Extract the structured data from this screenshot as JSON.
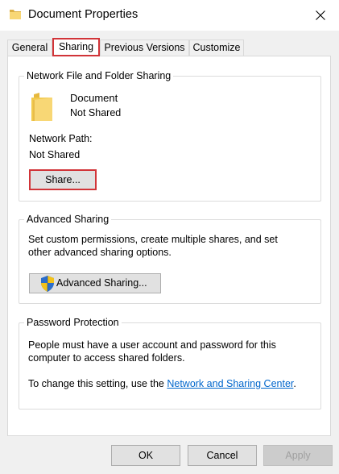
{
  "window": {
    "title": "Document Properties",
    "title_icon": "folder-icon",
    "close_icon": "close-icon"
  },
  "tabs": [
    {
      "label": "General"
    },
    {
      "label": "Sharing",
      "active": true
    },
    {
      "label": "Previous Versions"
    },
    {
      "label": "Customize"
    }
  ],
  "network_sharing": {
    "group_title": "Network File and Folder Sharing",
    "item_name": "Document",
    "item_status": "Not Shared",
    "path_label": "Network Path:",
    "path_value": "Not Shared",
    "share_button": "Share..."
  },
  "advanced_sharing": {
    "group_title": "Advanced Sharing",
    "description_line1": "Set custom permissions, create multiple shares, and set",
    "description_line2": "other advanced sharing options.",
    "button_label": "Advanced Sharing...",
    "button_icon": "uac-shield-icon"
  },
  "password_protection": {
    "group_title": "Password Protection",
    "line1": "People must have a user account and password for this",
    "line2": "computer to access shared folders.",
    "line3_prefix": "To change this setting, use the ",
    "link_text": "Network and Sharing Center",
    "line3_suffix": "."
  },
  "footer": {
    "ok": "OK",
    "cancel": "Cancel",
    "apply": "Apply"
  },
  "colors": {
    "highlight_red": "#d13438",
    "link_blue": "#0066cc",
    "folder_yellow": "#f8d775"
  }
}
